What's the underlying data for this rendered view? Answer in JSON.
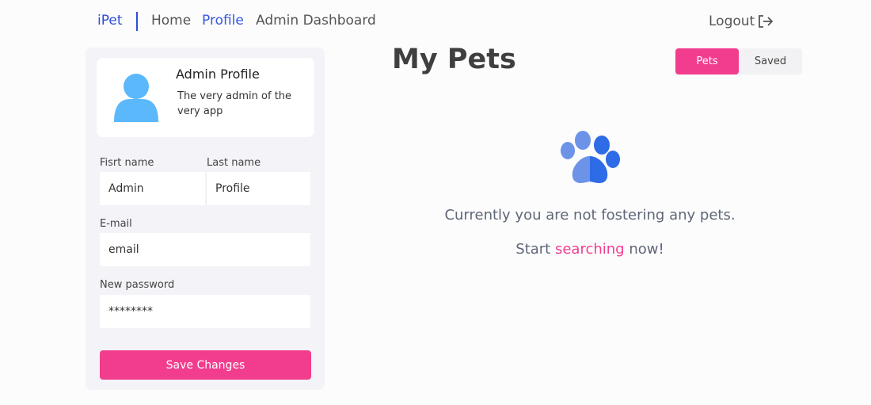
{
  "nav": {
    "brand": "iPet",
    "links": [
      {
        "label": "Home"
      },
      {
        "label": "Profile"
      },
      {
        "label": "Admin Dashboard"
      }
    ],
    "logout_label": "Logout"
  },
  "profile": {
    "name": "Admin Profile",
    "description": "The very admin of the very app",
    "first_name_label": "Fisrt name",
    "first_name_value": "Admin",
    "last_name_label": "Last name",
    "last_name_value": "Profile",
    "email_label": "E-mail",
    "email_value": "email",
    "password_label": "New password",
    "password_value": "********",
    "save_label": "Save Changes"
  },
  "main": {
    "title": "My Pets",
    "tabs": [
      {
        "label": "Pets",
        "active": true
      },
      {
        "label": "Saved",
        "active": false
      }
    ],
    "empty_message": "Currently you are not fostering any pets.",
    "cta_prefix": "Start",
    "cta_link": "searching",
    "cta_suffix": "now!"
  },
  "colors": {
    "brand_blue": "#2f4ed6",
    "accent_pink": "#f23d8e",
    "avatar_blue": "#5bb8fa",
    "paw_blue": "#2e6be6"
  },
  "icons": {
    "logout": "sign-out-icon",
    "avatar": "user-icon",
    "paw": "paw-icon"
  }
}
